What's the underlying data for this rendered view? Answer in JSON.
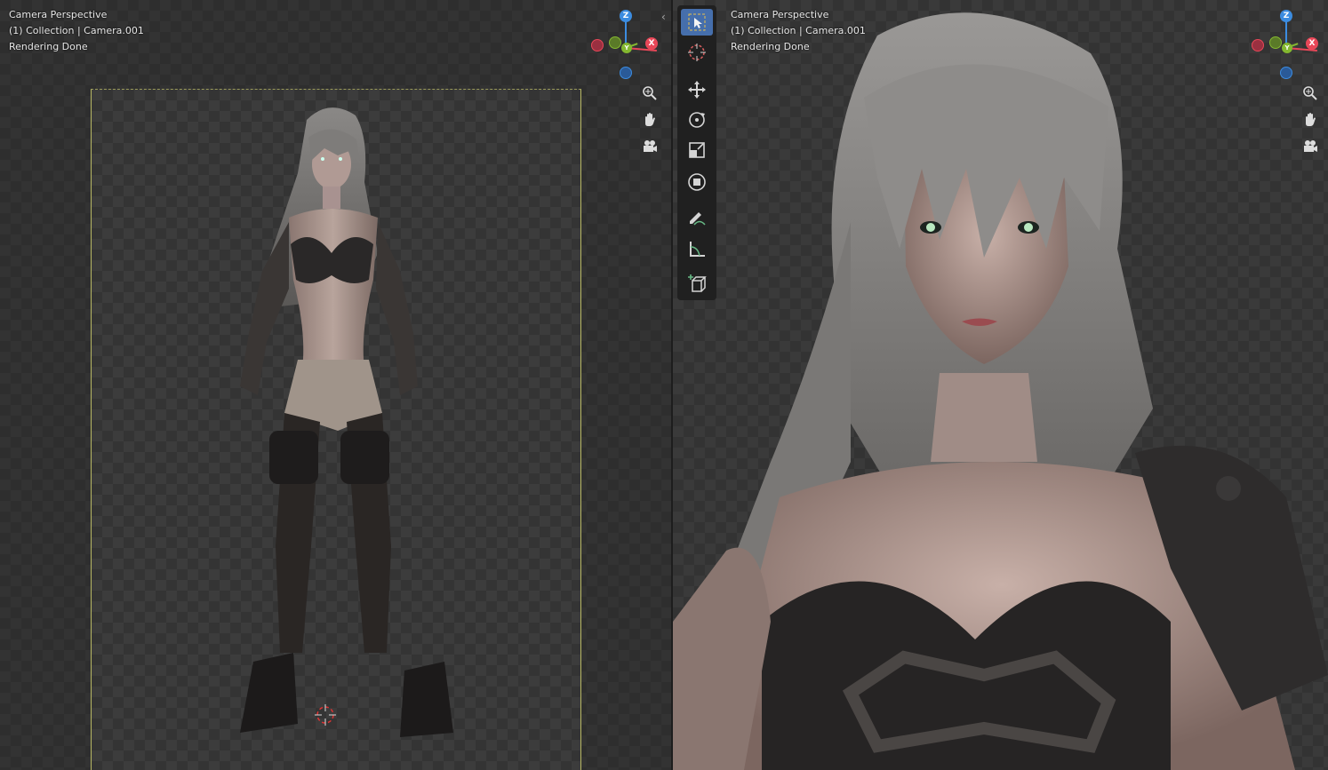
{
  "left_viewport": {
    "line1": "Camera Perspective",
    "line2": "(1) Collection | Camera.001",
    "line3": "Rendering Done"
  },
  "right_viewport": {
    "line1": "Camera Perspective",
    "line2": "(1) Collection | Camera.001",
    "line3": "Rendering Done"
  },
  "gizmo": {
    "z_label": "Z",
    "y_label": "Y",
    "x_label": "X",
    "colors": {
      "x": "#e84758",
      "y": "#84b830",
      "z": "#3c8ce0"
    }
  },
  "nav_icons": [
    "zoom-icon",
    "pan-hand-icon",
    "camera-view-icon"
  ],
  "toolbar": {
    "tools": [
      "select-box",
      "cursor",
      "move",
      "rotate",
      "scale",
      "transform",
      "annotate",
      "measure",
      "add-cube"
    ],
    "active": "select-box",
    "accent": "#4772b3"
  }
}
